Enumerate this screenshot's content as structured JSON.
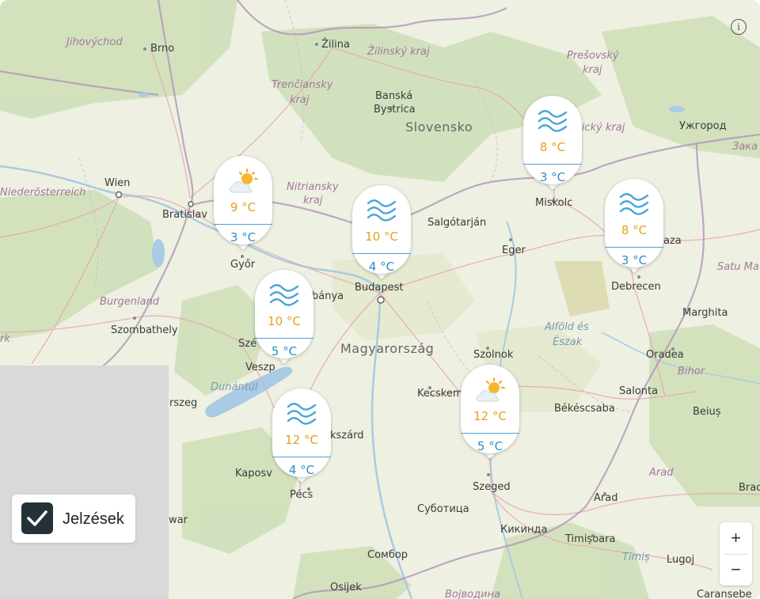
{
  "map": {
    "info_icon": "info-icon",
    "places": [
      {
        "id": "jihovychod",
        "text": "Jihovýchod",
        "kind": "region"
      },
      {
        "id": "brno",
        "text": "Brno",
        "kind": "city"
      },
      {
        "id": "zilina",
        "text": "Žilina",
        "kind": "city"
      },
      {
        "id": "zilinsky",
        "text": "Žilinský kraj",
        "kind": "region"
      },
      {
        "id": "presovsky1",
        "text": "Prešovský",
        "kind": "region"
      },
      {
        "id": "presovsky2",
        "text": "kraj",
        "kind": "region"
      },
      {
        "id": "trenciansky1",
        "text": "Trenčiansky",
        "kind": "region"
      },
      {
        "id": "trenciansky2",
        "text": "kraj",
        "kind": "region"
      },
      {
        "id": "banska1",
        "text": "Banská",
        "kind": "city"
      },
      {
        "id": "banska2",
        "text": "Bystrica",
        "kind": "city"
      },
      {
        "id": "slovensko",
        "text": "Slovensko",
        "kind": "country"
      },
      {
        "id": "kosicky",
        "text": "šický kraj",
        "kind": "region"
      },
      {
        "id": "uzhorod",
        "text": "Ужгород",
        "kind": "city"
      },
      {
        "id": "zaka",
        "text": "Зака",
        "kind": "region"
      },
      {
        "id": "wien",
        "text": "Wien",
        "kind": "city"
      },
      {
        "id": "niederosterreich",
        "text": "Niederösterreich",
        "kind": "region"
      },
      {
        "id": "bratislava",
        "text": "Bratislav",
        "kind": "city"
      },
      {
        "id": "nitriansky1",
        "text": "Nitriansky",
        "kind": "region"
      },
      {
        "id": "nitriansky2",
        "text": "kraj",
        "kind": "region"
      },
      {
        "id": "salgotarjan",
        "text": "Salgótarján",
        "kind": "city"
      },
      {
        "id": "miskolc",
        "text": "Miskolc",
        "kind": "city"
      },
      {
        "id": "eger",
        "text": "Eger",
        "kind": "city"
      },
      {
        "id": "gyor",
        "text": "Győr",
        "kind": "city"
      },
      {
        "id": "nyiregyhaza",
        "text": "aza",
        "kind": "city"
      },
      {
        "id": "satumare",
        "text": "Satu Ma",
        "kind": "region"
      },
      {
        "id": "debrecen",
        "text": "Debrecen",
        "kind": "city"
      },
      {
        "id": "budapest",
        "text": "Budapest",
        "kind": "city"
      },
      {
        "id": "tatabanya",
        "text": "bánya",
        "kind": "city"
      },
      {
        "id": "burgenland",
        "text": "Burgenland",
        "kind": "region"
      },
      {
        "id": "szombathely",
        "text": "Szombathely",
        "kind": "city"
      },
      {
        "id": "marghita",
        "text": "Marghita",
        "kind": "city"
      },
      {
        "id": "alfold1",
        "text": "Alföld és",
        "kind": "region"
      },
      {
        "id": "alfold2",
        "text": "Észak",
        "kind": "region"
      },
      {
        "id": "rk",
        "text": "rk",
        "kind": "region"
      },
      {
        "id": "szekesfehervar",
        "text": "Szé",
        "kind": "city"
      },
      {
        "id": "magyarorszag",
        "text": "Magyarország",
        "kind": "country"
      },
      {
        "id": "szolnok",
        "text": "Szolnok",
        "kind": "city"
      },
      {
        "id": "oradea",
        "text": "Oradea",
        "kind": "city"
      },
      {
        "id": "veszprem",
        "text": "Veszp",
        "kind": "city"
      },
      {
        "id": "bihor",
        "text": "Bihor",
        "kind": "region"
      },
      {
        "id": "dunantul",
        "text": "Dunántúl",
        "kind": "region"
      },
      {
        "id": "kecskemet",
        "text": "Kecskem",
        "kind": "city"
      },
      {
        "id": "zalaegerszeg",
        "text": "rszeg",
        "kind": "city"
      },
      {
        "id": "salonta",
        "text": "Salonta",
        "kind": "city"
      },
      {
        "id": "bekescsaba",
        "text": "Békéscsaba",
        "kind": "city"
      },
      {
        "id": "beius",
        "text": "Beiuș",
        "kind": "city"
      },
      {
        "id": "szekszard",
        "text": "ekszárd",
        "kind": "city"
      },
      {
        "id": "kaposvar",
        "text": "Kaposv",
        "kind": "city"
      },
      {
        "id": "arad_region",
        "text": "Arad",
        "kind": "region"
      },
      {
        "id": "szeged",
        "text": "Szeged",
        "kind": "city"
      },
      {
        "id": "pecs",
        "text": "Pécs",
        "kind": "city"
      },
      {
        "id": "arad",
        "text": "Arad",
        "kind": "city"
      },
      {
        "id": "brad",
        "text": "Brad",
        "kind": "city"
      },
      {
        "id": "subotica",
        "text": "Суботица",
        "kind": "city"
      },
      {
        "id": "nagykanizsa",
        "text": "war",
        "kind": "city"
      },
      {
        "id": "kikinda",
        "text": "Кикинда",
        "kind": "city"
      },
      {
        "id": "timisoara",
        "text": "Timișoara",
        "kind": "city"
      },
      {
        "id": "sombor",
        "text": "Сомбор",
        "kind": "city"
      },
      {
        "id": "timis",
        "text": "Timiș",
        "kind": "region"
      },
      {
        "id": "lugoj",
        "text": "Lugoj",
        "kind": "city"
      },
      {
        "id": "osijek",
        "text": "Osijek",
        "kind": "city"
      },
      {
        "id": "caransebes",
        "text": "Caransebe",
        "kind": "city"
      },
      {
        "id": "vojvodina",
        "text": "Војводина",
        "kind": "region"
      }
    ]
  },
  "markers": [
    {
      "id": "gyor",
      "icon": "sun-cloud-icon",
      "high": "9 °C",
      "low": "3 °C"
    },
    {
      "id": "budapest",
      "icon": "mist-icon",
      "high": "10 °C",
      "low": "4 °C"
    },
    {
      "id": "miskolc",
      "icon": "mist-icon",
      "high": "8 °C",
      "low": "3 °C"
    },
    {
      "id": "debrecen",
      "icon": "mist-icon",
      "high": "8 °C",
      "low": "3 °C"
    },
    {
      "id": "veszprem",
      "icon": "mist-icon",
      "high": "10 °C",
      "low": "5 °C"
    },
    {
      "id": "pecs",
      "icon": "mist-icon",
      "high": "12 °C",
      "low": "4 °C"
    },
    {
      "id": "szeged",
      "icon": "sun-cloud-icon",
      "high": "12 °C",
      "low": "5 °C"
    }
  ],
  "controls": {
    "toggle_label": "Jelzések",
    "toggle_checked": true,
    "zoom_in": "+",
    "zoom_out": "−"
  }
}
